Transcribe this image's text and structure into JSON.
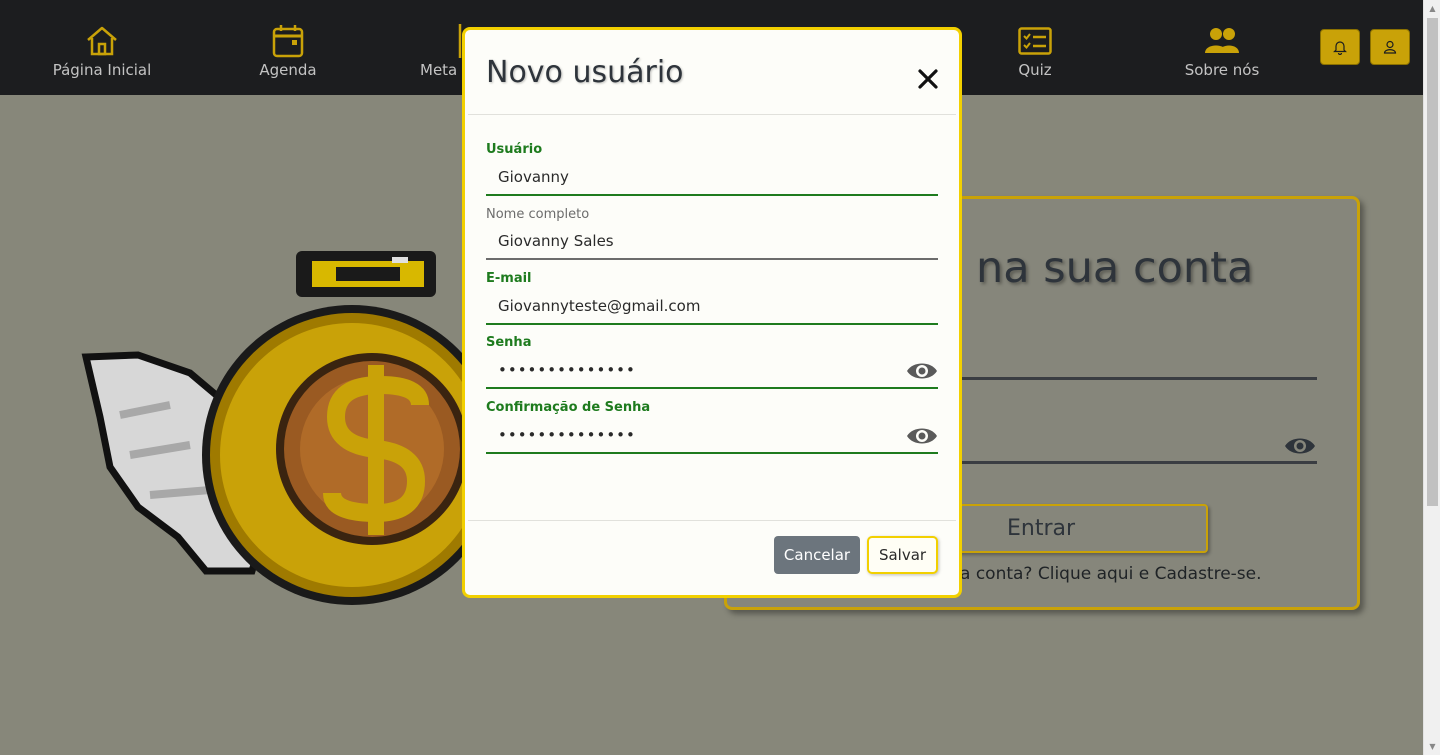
{
  "nav": {
    "items": [
      {
        "label": "Página Inicial",
        "icon": "home-icon"
      },
      {
        "label": "Agenda",
        "icon": "calendar-icon"
      },
      {
        "label": "Meta",
        "icon": "goal-icon"
      },
      {
        "label": "Quiz",
        "icon": "checklist-icon"
      },
      {
        "label": "Sobre nós",
        "icon": "users-icon"
      }
    ],
    "buttons": [
      {
        "icon": "bell-icon"
      },
      {
        "icon": "user-icon"
      }
    ]
  },
  "background": {
    "login_title": "na sua conta",
    "enter_label": "Entrar",
    "signup_text": "a conta? Clique aqui e Cadastre-se."
  },
  "modal": {
    "title": "Novo usuário",
    "close_icon": "close-icon",
    "fields": {
      "username": {
        "label": "Usuário",
        "value": "Giovanny"
      },
      "fullname": {
        "label": "Nome completo",
        "value": "Giovanny Sales"
      },
      "email": {
        "label": "E-mail",
        "value": "Giovannyteste@gmail.com"
      },
      "password": {
        "label": "Senha",
        "value": "••••••••••••••"
      },
      "confirm_password": {
        "label": "Confirmação de Senha",
        "value": "••••••••••••••"
      }
    },
    "cancel_label": "Cancelar",
    "save_label": "Salvar"
  },
  "colors": {
    "accent": "#c9a208",
    "modal_border": "#f2d000",
    "valid_green": "#1e7b1e",
    "nav_bg": "#1c1d1f",
    "cancel_bg": "#6c757d"
  }
}
